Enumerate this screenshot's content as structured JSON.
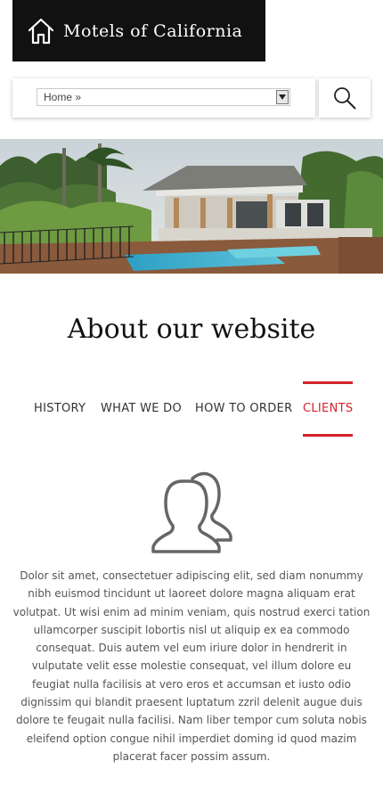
{
  "header": {
    "brand": "Motels of California",
    "home_icon": "house-outline-icon"
  },
  "breadcrumb": {
    "selected": "Home »",
    "arrow_icon": "dropdown-arrow-icon"
  },
  "search": {
    "icon": "magnifier-icon"
  },
  "hero": {
    "description": "modern house with swimming pool"
  },
  "about": {
    "title": "About our website",
    "tabs": [
      {
        "label": "HISTORY",
        "active": false
      },
      {
        "label": "WHAT WE DO",
        "active": false
      },
      {
        "label": "HOW TO ORDER",
        "active": false
      },
      {
        "label": "CLIENTS",
        "active": true
      }
    ],
    "active_icon": "users-icon",
    "text": "Dolor sit amet, consectetuer adipiscing elit, sed diam nonummy nibh euismod tincidunt ut laoreet dolore magna aliquam erat volutpat. Ut wisi enim ad minim veniam, quis nostrud exerci tation ullamcorper suscipit lobortis nisl ut aliquip ex ea commodo consequat. Duis autem vel eum iriure dolor in hendrerit in vulputate velit esse molestie consequat, vel illum dolore eu feugiat nulla facilisis at vero eros et accumsan et iusto odio dignissim qui blandit praesent luptatum zzril delenit augue duis dolore te feugait nulla facilisi. Nam liber tempor cum soluta nobis eleifend option congue nihil imperdiet doming id quod mazim placerat facer possim assum."
  },
  "colors": {
    "accent": "#d2232a",
    "header_bg": "#111111"
  }
}
